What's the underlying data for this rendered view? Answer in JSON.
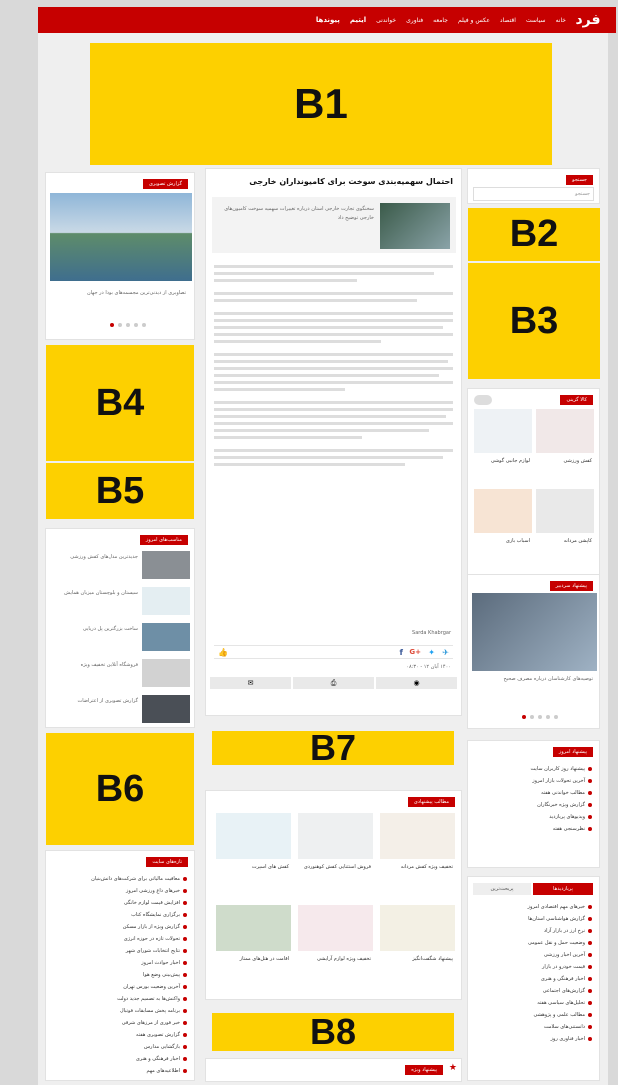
{
  "header": {
    "logo": "فرد",
    "menu": [
      "خانه",
      "سیاست",
      "اقتصاد",
      "عکس و فیلم",
      "جامعه",
      "فناوری",
      "خواندنی",
      "ایتیم",
      "پیوندها"
    ]
  },
  "ads": {
    "b1": "B1",
    "b2": "B2",
    "b3": "B3",
    "b4": "B4",
    "b5": "B5",
    "b6": "B6",
    "b7": "B7",
    "b8": "B8"
  },
  "article": {
    "title": "احتمال سهمیه‌بندی سوخت برای کامیونداران خارجی",
    "byline": "Sarda Khabrgar",
    "date": "۱۴۰۰ آبان ۱۲ - ۰۸:۳۰"
  },
  "left": {
    "gallery_title": "گزارش تصویری",
    "gallery_caption": "تصاویری از دیدنی‌ترین مجسمه‌های بودا در جهان",
    "recent_title": "مناسب‌های امروز"
  },
  "right": {
    "search_title": "جستجو",
    "search_placeholder": "جستجو",
    "shop_title": "کالا گزینی",
    "related_title": "پیشنهاد سردبیر",
    "video_title": "پیشنهاد امروز",
    "tabs": [
      "پربازدیدها",
      "پربحث‌ترین"
    ]
  },
  "bottom": {
    "suggest_title": "مطالب پیشنهادی",
    "notes_title": "تازه‌های سایت",
    "more_title": "پیشنهاد ویژه"
  },
  "colors": {
    "brand": "#c60000",
    "ad": "#fdd000"
  }
}
